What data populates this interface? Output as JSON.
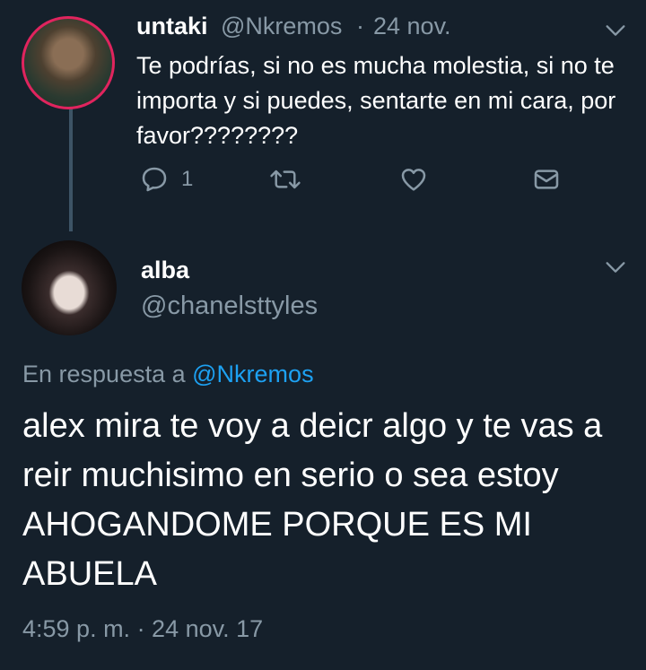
{
  "tweet1": {
    "name": "untaki",
    "handle": "@Nkremos",
    "separator": "·",
    "date": "24 nov.",
    "text": "Te podrías, si no es mucha molestia, si no te importa y si puedes, sentarte en mi cara, por favor????????",
    "reply_count": "1",
    "icons": [
      "reply-icon",
      "retweet-icon",
      "like-icon",
      "message-icon",
      "chevron-down-icon"
    ]
  },
  "tweet2": {
    "name": "alba",
    "handle": "@chanelsttyles",
    "reply_prefix": "En respuesta a",
    "reply_mention": "@Nkremos",
    "text": "alex mira te voy a deicr algo y te vas a reir muchisimo en serio o sea estoy AHOGANDOME PORQUE ES MI ABUELA",
    "timestamp": "4:59 p. m. · 24 nov. 17"
  },
  "colors": {
    "background": "#15202b",
    "secondary": "#8899a6",
    "accent": "#1da1f2",
    "thread_line": "#3d5466"
  }
}
